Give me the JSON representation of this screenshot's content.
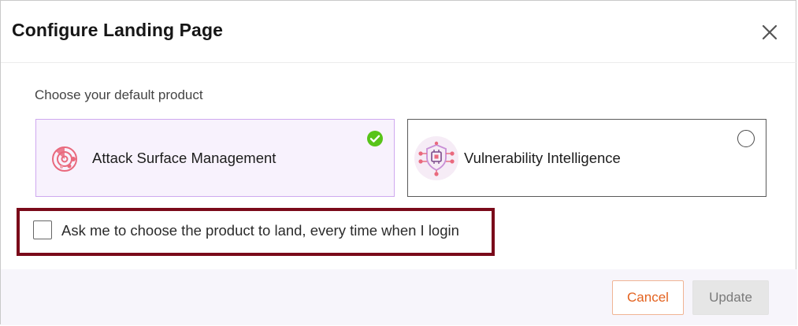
{
  "dialog": {
    "title": "Configure Landing Page",
    "subtitle": "Choose your default product"
  },
  "products": [
    {
      "label": "Attack Surface Management",
      "icon": "radar-target-icon",
      "selected": true
    },
    {
      "label": "Vulnerability Intelligence",
      "icon": "shield-chip-icon",
      "selected": false
    }
  ],
  "ask_option": {
    "label": "Ask me to choose the product to land, every time when I login",
    "checked": false
  },
  "footer": {
    "cancel_label": "Cancel",
    "update_label": "Update"
  },
  "colors": {
    "accent_orange": "#e3621f",
    "selected_card_bg": "#f8f2fd",
    "selected_card_border": "#cfa9ef",
    "check_green": "#58c419",
    "icon_pink": "#e9697d",
    "highlight_border": "#7a0a1a"
  }
}
